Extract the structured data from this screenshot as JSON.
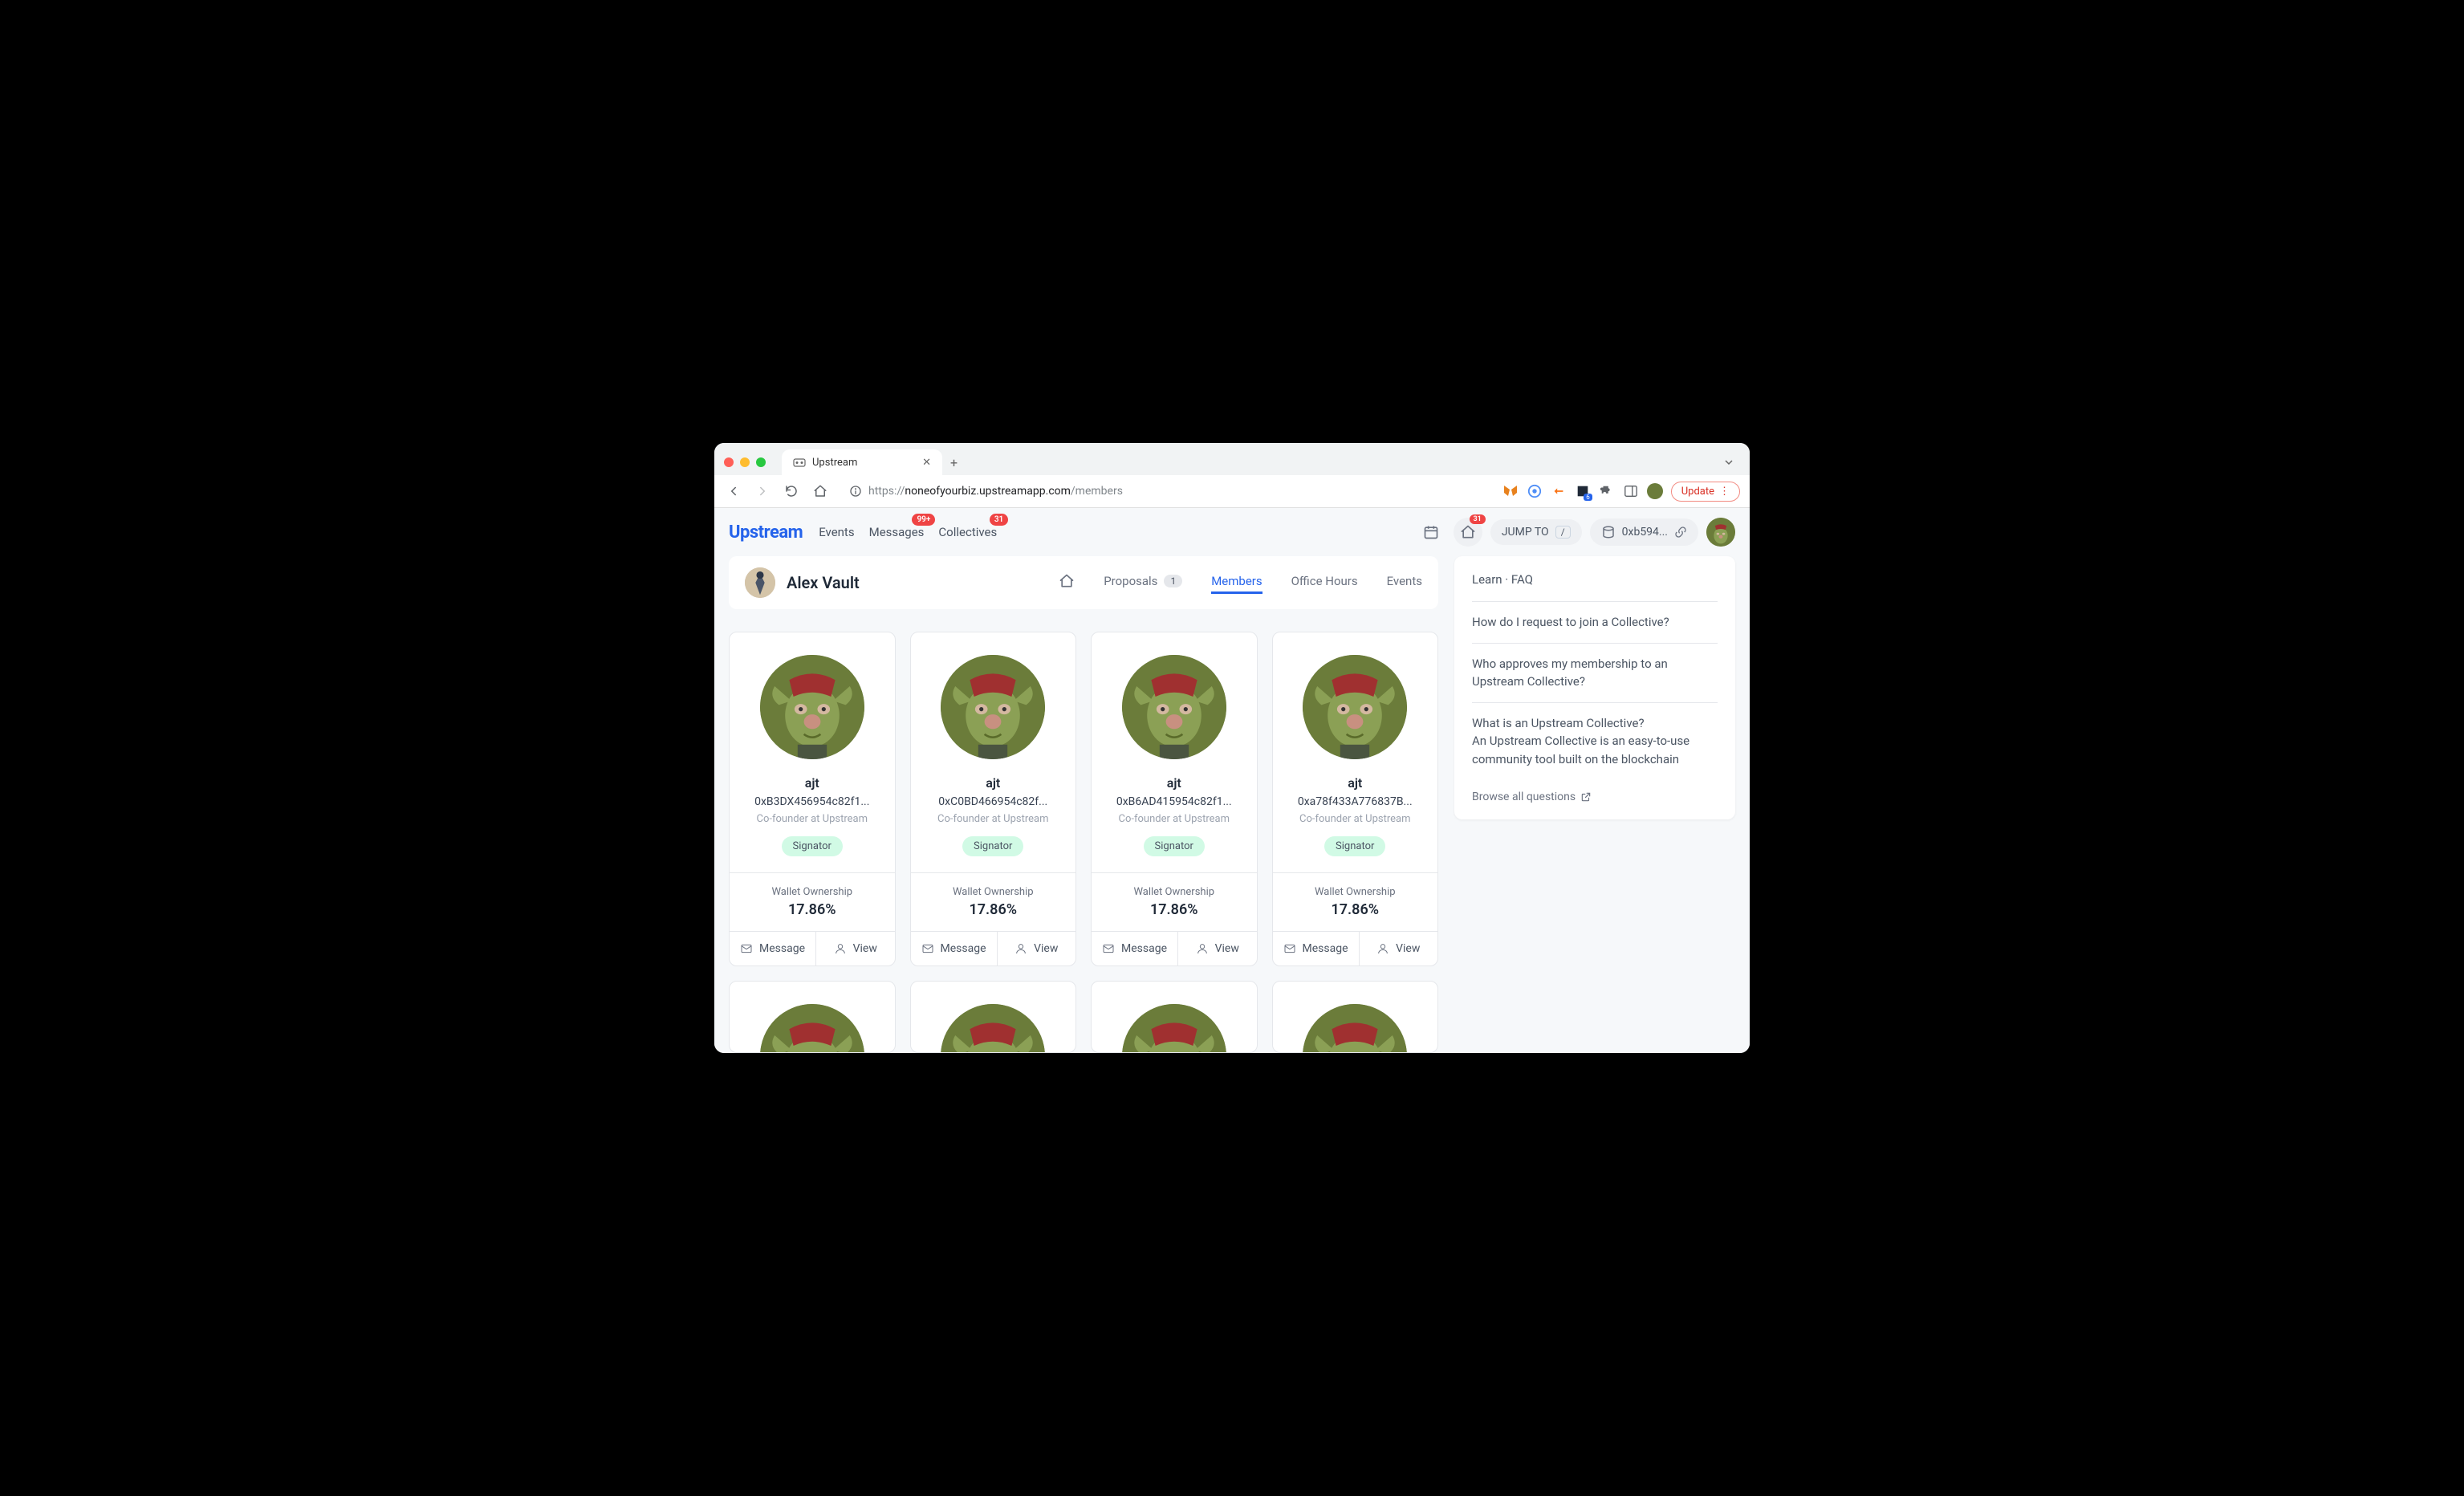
{
  "browser": {
    "tab_title": "Upstream",
    "url_prefix": "https://",
    "url_host": "noneofyourbiz.upstreamapp.com",
    "url_path": "/members",
    "update_label": "Update"
  },
  "header": {
    "logo": "Upstream",
    "nav": {
      "events": "Events",
      "messages": "Messages",
      "messages_badge": "99+",
      "collectives": "Collectives",
      "collectives_badge": "31"
    },
    "home_badge": "31",
    "jump_label": "JUMP TO",
    "jump_key": "/",
    "wallet": "0xb594..."
  },
  "collective": {
    "name": "Alex Vault",
    "tabs": {
      "proposals": "Proposals",
      "proposals_count": "1",
      "members": "Members",
      "office_hours": "Office Hours",
      "events": "Events"
    }
  },
  "members": [
    {
      "name": "ajt",
      "address": "0xB3DX456954c82f1...",
      "role": "Co-founder at Upstream",
      "badge": "Signator",
      "wallet_label": "Wallet Ownership",
      "wallet_pct": "17.86%",
      "message": "Message",
      "view": "View"
    },
    {
      "name": "ajt",
      "address": "0xC0BD466954c82f...",
      "role": "Co-founder at Upstream",
      "badge": "Signator",
      "wallet_label": "Wallet Ownership",
      "wallet_pct": "17.86%",
      "message": "Message",
      "view": "View"
    },
    {
      "name": "ajt",
      "address": "0xB6AD415954c82f1...",
      "role": "Co-founder at Upstream",
      "badge": "Signator",
      "wallet_label": "Wallet Ownership",
      "wallet_pct": "17.86%",
      "message": "Message",
      "view": "View"
    },
    {
      "name": "ajt",
      "address": "0xa78f433A776837B...",
      "role": "Co-founder at Upstream",
      "badge": "Signator",
      "wallet_label": "Wallet Ownership",
      "wallet_pct": "17.86%",
      "message": "Message",
      "view": "View"
    }
  ],
  "faq": {
    "title": "Learn · FAQ",
    "q1": "How do I request to join a Collective?",
    "q2": "Who approves my membership to an Upstream Collective?",
    "q3": "What is an Upstream Collective?\nAn Upstream Collective is an easy-to-use community tool built on the blockchain",
    "browse": "Browse all questions"
  }
}
